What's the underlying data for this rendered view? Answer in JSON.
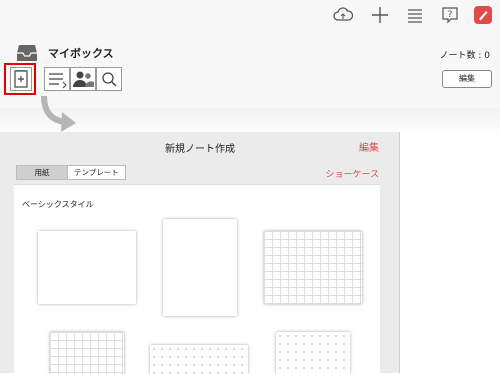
{
  "top_toolbar": {
    "icons": [
      "cloud-sync-icon",
      "plus-icon",
      "list-icon",
      "help-icon",
      "pen-app-icon"
    ],
    "accent": "#e24a4a"
  },
  "mybox": {
    "title": "マイボックス",
    "note_count": "ノート数 : 0",
    "edit_label": "編集"
  },
  "tools": [
    "new-note-icon",
    "sort-icon",
    "users-icon",
    "search-icon"
  ],
  "panel": {
    "title": "新規ノート作成",
    "edit_label": "編集",
    "tabs": [
      "用紙",
      "テンプレート"
    ],
    "selected_tab": "用紙",
    "showcase_label": "ショーケース",
    "section_title": "ベーシックスタイル",
    "accent": "#d94a4a",
    "papers": [
      "plain",
      "plain-portrait",
      "grid",
      "grid",
      "dots",
      "dots"
    ]
  }
}
